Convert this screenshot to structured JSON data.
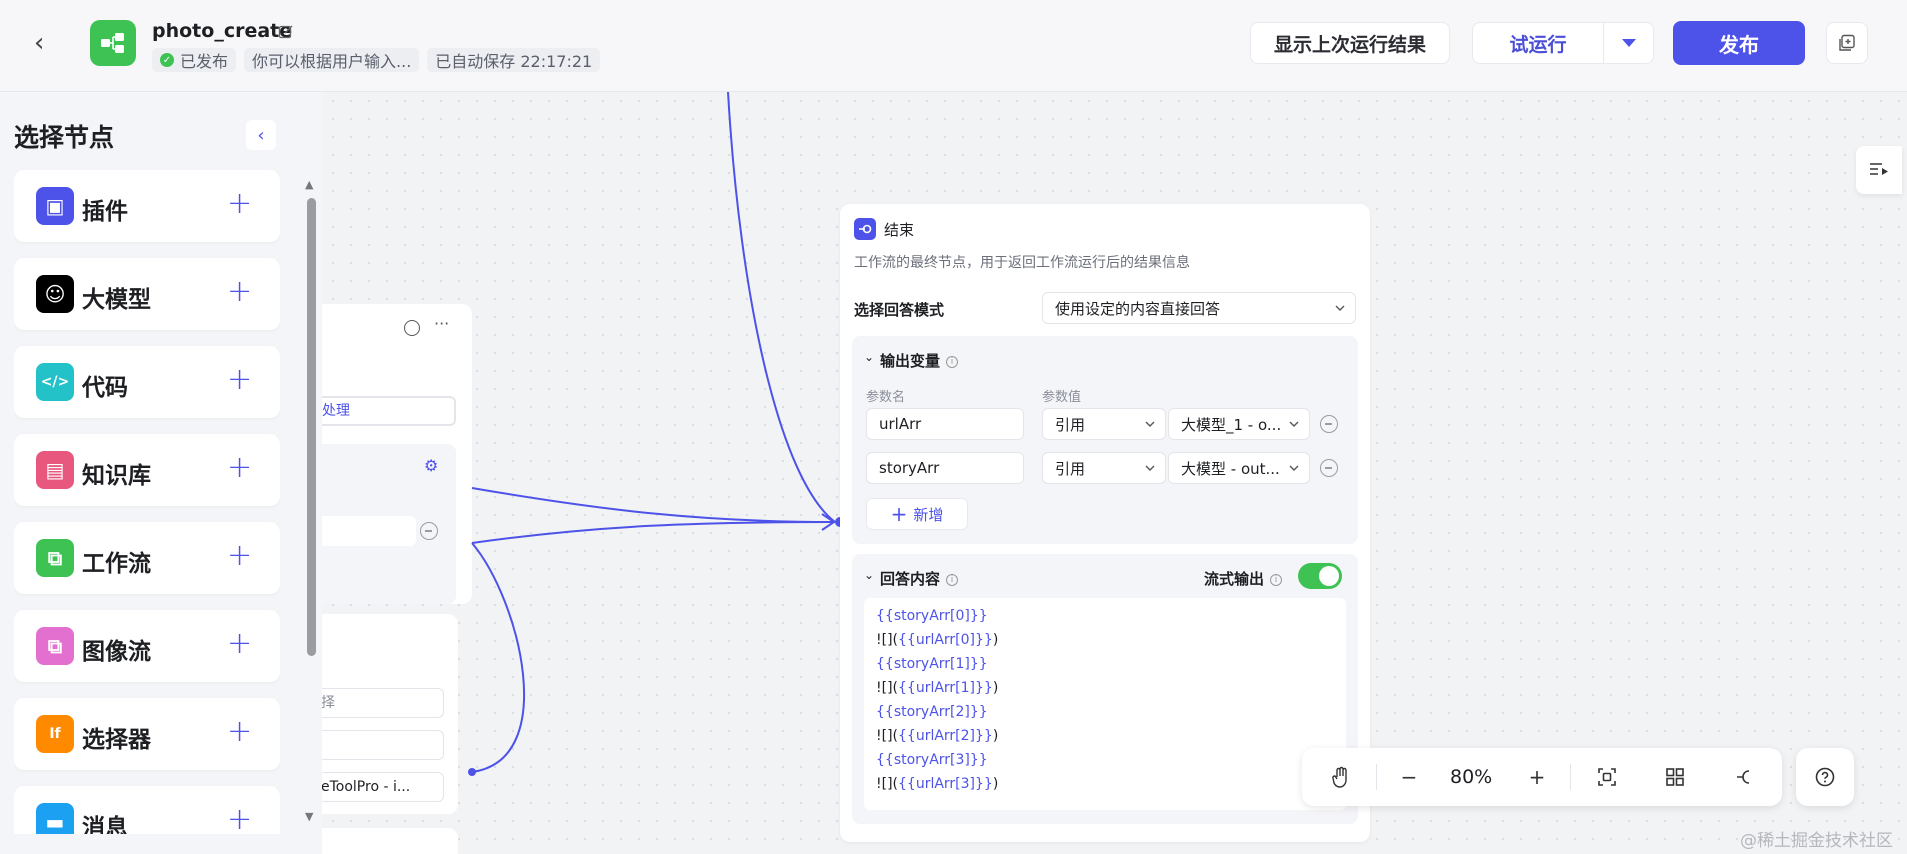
{
  "header": {
    "app_title": "photo_create",
    "status": "已发布",
    "description": "你可以根据用户输入...",
    "autosave": "已自动保存 22:17:21",
    "show_last_result": "显示上次运行结果",
    "test_run": "试运行",
    "publish": "发布"
  },
  "left_panel": {
    "title": "选择节点",
    "items": [
      {
        "label": "插件",
        "icon": "plugin-icon",
        "color": "#4d53e8"
      },
      {
        "label": "大模型",
        "icon": "llm-icon",
        "color": "#000000"
      },
      {
        "label": "代码",
        "icon": "code-icon",
        "color": "#23c2c9"
      },
      {
        "label": "知识库",
        "icon": "knowledge-icon",
        "color": "#e8577d"
      },
      {
        "label": "工作流",
        "icon": "workflow-icon",
        "color": "#3ec254"
      },
      {
        "label": "图像流",
        "icon": "imageflow-icon",
        "color": "#e36fcf"
      },
      {
        "label": "选择器",
        "icon": "selector-icon",
        "color": "#ff8a00"
      },
      {
        "label": "消息",
        "icon": "message-icon",
        "color": "#1ca1f2"
      }
    ]
  },
  "partial_node": {
    "tag": "处理",
    "text1": "择",
    "text2": "eToolPro - i..."
  },
  "end_node": {
    "title": "结束",
    "description": "工作流的最终节点，用于返回工作流运行后的结果信息",
    "mode_label": "选择回答模式",
    "mode_value": "使用设定的内容直接回答",
    "output_section": {
      "title": "输出变量",
      "col_name": "参数名",
      "col_value": "参数值",
      "rows": [
        {
          "name": "urlArr",
          "type": "引用",
          "ref": "大模型_1 - o..."
        },
        {
          "name": "storyArr",
          "type": "引用",
          "ref": "大模型 - out..."
        }
      ],
      "add_label": "新增"
    },
    "answer_section": {
      "title": "回答内容",
      "stream_label": "流式输出",
      "stream_on": true,
      "lines": [
        {
          "prefix": "",
          "var": "{{storyArr[0]}}",
          "suffix": ""
        },
        {
          "prefix": "![](",
          "var": "{{urlArr[0]}}",
          "suffix": ")"
        },
        {
          "prefix": "",
          "var": "{{storyArr[1]}}",
          "suffix": ""
        },
        {
          "prefix": "![](",
          "var": "{{urlArr[1]}}",
          "suffix": ")"
        },
        {
          "prefix": "",
          "var": "{{storyArr[2]}}",
          "suffix": ""
        },
        {
          "prefix": "![](",
          "var": "{{urlArr[2]}}",
          "suffix": ")"
        },
        {
          "prefix": "",
          "var": "{{storyArr[3]}}",
          "suffix": ""
        },
        {
          "prefix": "![](",
          "var": "{{urlArr[3]}}",
          "suffix": ")"
        }
      ]
    }
  },
  "toolbar": {
    "zoom": "80%",
    "icons": [
      "hand-icon",
      "zoom-out-icon",
      "zoom-in-icon",
      "fit-view-icon",
      "layout-icon",
      "connector-icon"
    ]
  },
  "watermark": "@稀土掘金技术社区",
  "colors": {
    "accent": "#4d53e8",
    "success": "#3ec254",
    "wire": "#4d53e8"
  }
}
